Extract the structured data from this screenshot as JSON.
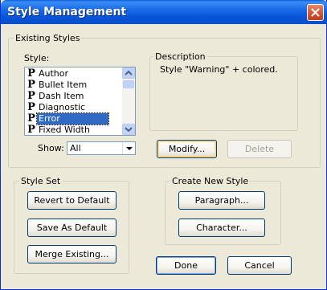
{
  "window": {
    "title": "Style Management"
  },
  "existing_styles": {
    "legend": "Existing Styles",
    "style_label": "Style:",
    "styles": [
      {
        "icon": "P",
        "label": "Author",
        "selected": false
      },
      {
        "icon": "P",
        "label": "Bullet Item",
        "selected": false
      },
      {
        "icon": "P",
        "label": "Dash Item",
        "selected": false
      },
      {
        "icon": "P",
        "label": "Diagnostic",
        "selected": false
      },
      {
        "icon": "P",
        "label": "Error",
        "selected": true
      },
      {
        "icon": "P",
        "label": "Fixed Width",
        "selected": false
      }
    ],
    "show_label": "Show:",
    "show_value": "All",
    "description_legend": "Description",
    "description_text": "Style \"Warning\" + colored.",
    "modify_label": "Modify...",
    "delete_label": "Delete"
  },
  "style_set": {
    "legend": "Style Set",
    "revert_label": "Revert to Default",
    "save_label": "Save As Default",
    "merge_label": "Merge Existing..."
  },
  "create_new_style": {
    "legend": "Create New Style",
    "paragraph_label": "Paragraph...",
    "character_label": "Character..."
  },
  "footer": {
    "done_label": "Done",
    "cancel_label": "Cancel"
  },
  "icons": {
    "close": "close-x-icon",
    "paragraph_style": "paragraph-style-icon",
    "dropdown": "chevron-down-icon",
    "scroll_up": "scroll-up-arrow-icon",
    "scroll_down": "scroll-down-arrow-icon"
  }
}
